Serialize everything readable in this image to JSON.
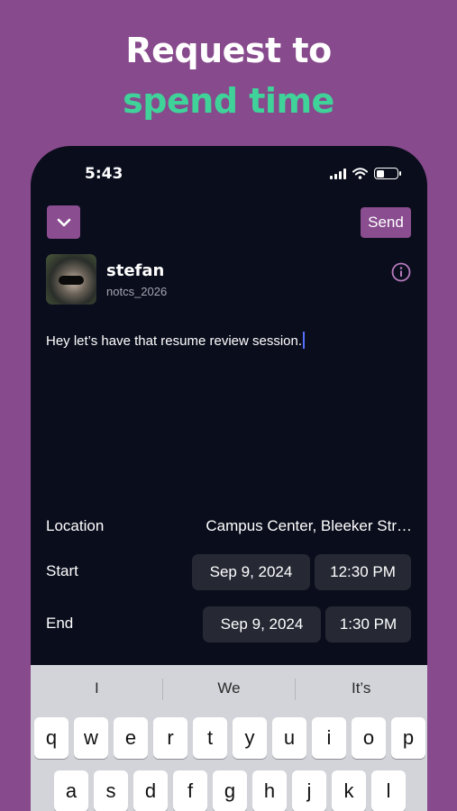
{
  "promo": {
    "line1": "Request to",
    "line2": "spend time"
  },
  "status_bar": {
    "time": "5:43",
    "icons": [
      "cellular-signal-icon",
      "wifi-icon",
      "battery-icon"
    ]
  },
  "header": {
    "collapse_icon": "chevron-down-icon",
    "send_label": "Send"
  },
  "recipient": {
    "name": "stefan",
    "handle": "notcs_2026",
    "info_icon": "info-icon"
  },
  "message": {
    "text": "Hey let’s have that resume review session."
  },
  "details": {
    "location_label": "Location",
    "location_value": "Campus Center, Bleeker Str…",
    "start_label": "Start",
    "start_date": "Sep 9, 2024",
    "start_time": "12:30 PM",
    "end_label": "End",
    "end_date": "Sep 9, 2024",
    "end_time": "1:30 PM"
  },
  "keyboard": {
    "suggestions": [
      "I",
      "We",
      "It’s"
    ],
    "row1": [
      "q",
      "w",
      "e",
      "r",
      "t",
      "y",
      "u",
      "i",
      "o",
      "p"
    ],
    "row2": [
      "a",
      "s",
      "d",
      "f",
      "g",
      "h",
      "j",
      "k",
      "l"
    ]
  },
  "colors": {
    "background": "#874a8c",
    "accent": "#8a4d90",
    "highlight": "#3fd39a",
    "screen": "#0a0d1c"
  }
}
